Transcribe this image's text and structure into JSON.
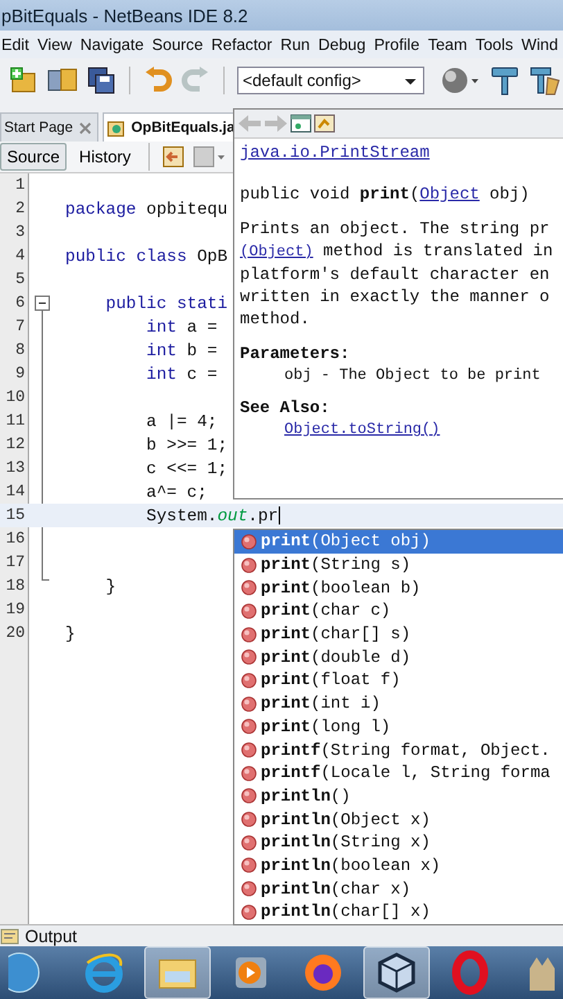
{
  "window": {
    "title": "pBitEquals - NetBeans IDE 8.2"
  },
  "menu": [
    "Edit",
    "View",
    "Navigate",
    "Source",
    "Refactor",
    "Run",
    "Debug",
    "Profile",
    "Team",
    "Tools",
    "Wind"
  ],
  "toolbar": {
    "config": "<default config>"
  },
  "tabs": [
    {
      "label": "Start Page",
      "selected": false
    },
    {
      "label": "OpBitEquals.ja",
      "selected": true
    }
  ],
  "editor_views": [
    {
      "label": "Source",
      "selected": true
    },
    {
      "label": "History",
      "selected": false
    }
  ],
  "code_lines": [
    {
      "number": "1",
      "current": false
    },
    {
      "number": "2",
      "current": false,
      "segments": [
        {
          "kind": "keyword",
          "text": "package"
        },
        {
          "kind": "plain",
          "text": " opbitequ"
        }
      ]
    },
    {
      "number": "3",
      "current": false
    },
    {
      "number": "4",
      "current": false,
      "segments": [
        {
          "kind": "keyword",
          "text": "public class"
        },
        {
          "kind": "plain",
          "text": " OpB"
        }
      ]
    },
    {
      "number": "5",
      "current": false
    },
    {
      "number": "6",
      "current": false,
      "segments": [
        {
          "kind": "keyword",
          "text": "    public stati"
        }
      ]
    },
    {
      "number": "7",
      "current": false,
      "segments": [
        {
          "kind": "keyword",
          "text": "        int"
        },
        {
          "kind": "plain",
          "text": " a ="
        }
      ]
    },
    {
      "number": "8",
      "current": false,
      "segments": [
        {
          "kind": "keyword",
          "text": "        int"
        },
        {
          "kind": "plain",
          "text": " b ="
        }
      ]
    },
    {
      "number": "9",
      "current": false,
      "segments": [
        {
          "kind": "keyword",
          "text": "        int"
        },
        {
          "kind": "plain",
          "text": " c ="
        }
      ]
    },
    {
      "number": "10",
      "current": false
    },
    {
      "number": "11",
      "current": false,
      "segments": [
        {
          "kind": "plain",
          "text": "        a |= 4;"
        }
      ]
    },
    {
      "number": "12",
      "current": false,
      "segments": [
        {
          "kind": "plain",
          "text": "        b >>= 1;"
        }
      ]
    },
    {
      "number": "13",
      "current": false,
      "segments": [
        {
          "kind": "plain",
          "text": "        c <<= 1;"
        }
      ]
    },
    {
      "number": "14",
      "current": false,
      "segments": [
        {
          "kind": "plain",
          "text": "        a^= c;"
        }
      ]
    },
    {
      "number": "15",
      "current": true,
      "segments": [
        {
          "kind": "plain",
          "text": "        System."
        },
        {
          "kind": "field",
          "text": "out"
        },
        {
          "kind": "plain",
          "text": ".pr"
        }
      ]
    },
    {
      "number": "16",
      "current": false
    },
    {
      "number": "17",
      "current": false
    },
    {
      "number": "18",
      "current": false,
      "segments": [
        {
          "kind": "plain",
          "text": "    }"
        }
      ]
    },
    {
      "number": "19",
      "current": false
    },
    {
      "number": "20",
      "current": false,
      "segments": [
        {
          "kind": "plain",
          "text": "}"
        }
      ]
    }
  ],
  "javadoc": {
    "class_link": "java.io.PrintStream",
    "signature": [
      {
        "kind": "text",
        "text": "public void **print**("
      },
      {
        "kind": "link",
        "text": "Object"
      },
      {
        "kind": "text",
        "text": " obj)"
      }
    ],
    "description": [
      [
        {
          "kind": "text",
          "text": "Prints an object. The string pr"
        }
      ],
      [
        {
          "kind": "link",
          "text": "(Object)"
        },
        {
          "kind": "text",
          "text": " method is translated in"
        }
      ],
      [
        {
          "kind": "text",
          "text": "platform's default character en"
        }
      ],
      [
        {
          "kind": "text",
          "text": "written in exactly the manner o"
        }
      ],
      [
        {
          "kind": "text",
          "text": "method."
        }
      ]
    ],
    "parameters_heading": "Parameters:",
    "parameter": "obj - The Object to be print",
    "see_also_heading": "See Also:",
    "see_also_link": "Object.toString()"
  },
  "completions": [
    {
      "method": "print",
      "signature": "(Object obj)",
      "selected": true
    },
    {
      "method": "print",
      "signature": "(String s)",
      "selected": false
    },
    {
      "method": "print",
      "signature": "(boolean b)",
      "selected": false
    },
    {
      "method": "print",
      "signature": "(char c)",
      "selected": false
    },
    {
      "method": "print",
      "signature": "(char[] s)",
      "selected": false
    },
    {
      "method": "print",
      "signature": "(double d)",
      "selected": false
    },
    {
      "method": "print",
      "signature": "(float f)",
      "selected": false
    },
    {
      "method": "print",
      "signature": "(int i)",
      "selected": false
    },
    {
      "method": "print",
      "signature": "(long l)",
      "selected": false
    },
    {
      "method": "printf",
      "signature": "(String format, Object.",
      "selected": false
    },
    {
      "method": "printf",
      "signature": "(Locale l, String forma",
      "selected": false
    },
    {
      "method": "println",
      "signature": "()",
      "selected": false
    },
    {
      "method": "println",
      "signature": "(Object x)",
      "selected": false
    },
    {
      "method": "println",
      "signature": "(String x)",
      "selected": false
    },
    {
      "method": "println",
      "signature": "(boolean x)",
      "selected": false
    },
    {
      "method": "println",
      "signature": "(char x)",
      "selected": false
    },
    {
      "method": "println",
      "signature": "(char[] x)",
      "selected": false
    }
  ],
  "output_panel": {
    "label": "Output"
  },
  "taskbar": [
    {
      "kind": "start",
      "active": false
    },
    {
      "kind": "ie",
      "active": false
    },
    {
      "kind": "folder",
      "active": true
    },
    {
      "kind": "media",
      "active": false
    },
    {
      "kind": "firefox",
      "active": false
    },
    {
      "kind": "cube",
      "active": true
    },
    {
      "kind": "opera",
      "active": false
    },
    {
      "kind": "emblem",
      "active": false
    }
  ]
}
